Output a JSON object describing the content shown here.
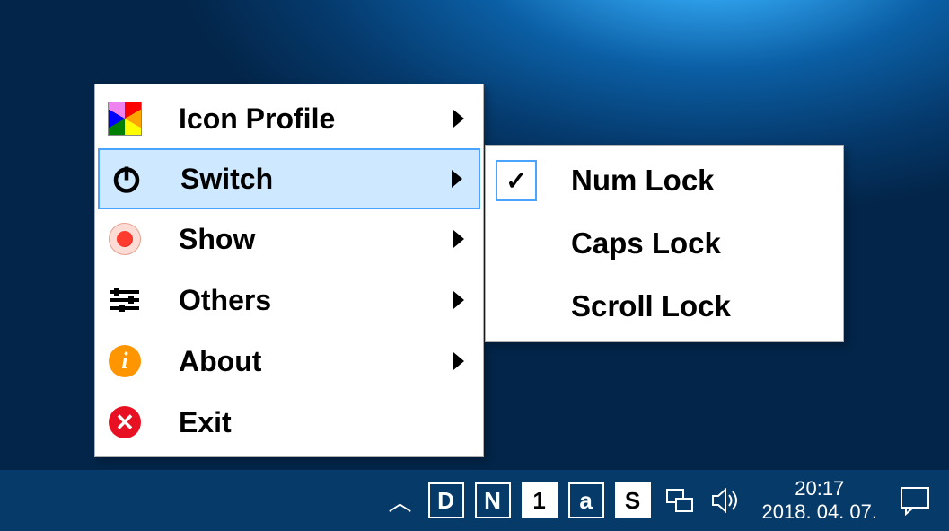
{
  "menu": {
    "items": [
      {
        "label": "Icon Profile",
        "icon": "rainbow-icon",
        "has_submenu": true,
        "selected": false
      },
      {
        "label": "Switch",
        "icon": "power-icon",
        "has_submenu": true,
        "selected": true
      },
      {
        "label": "Show",
        "icon": "eye-icon",
        "has_submenu": true,
        "selected": false
      },
      {
        "label": "Others",
        "icon": "sliders-icon",
        "has_submenu": true,
        "selected": false
      },
      {
        "label": "About",
        "icon": "info-icon",
        "has_submenu": true,
        "selected": false
      },
      {
        "label": "Exit",
        "icon": "close-icon",
        "has_submenu": false,
        "selected": false
      }
    ]
  },
  "submenu": {
    "items": [
      {
        "label": "Num Lock",
        "checked": true
      },
      {
        "label": "Caps Lock",
        "checked": false
      },
      {
        "label": "Scroll Lock",
        "checked": false
      }
    ]
  },
  "taskbar": {
    "tray_icons": [
      {
        "letter": "D",
        "style": "outline"
      },
      {
        "letter": "N",
        "style": "outline"
      },
      {
        "letter": "1",
        "style": "white"
      },
      {
        "letter": "a",
        "style": "outline"
      },
      {
        "letter": "S",
        "style": "white"
      }
    ],
    "clock": {
      "time": "20:17",
      "date": "2018. 04. 07."
    }
  },
  "colors": {
    "highlight_bg": "#cde8ff",
    "highlight_border": "#4aa3ff",
    "taskbar_bg": "#063a69"
  }
}
